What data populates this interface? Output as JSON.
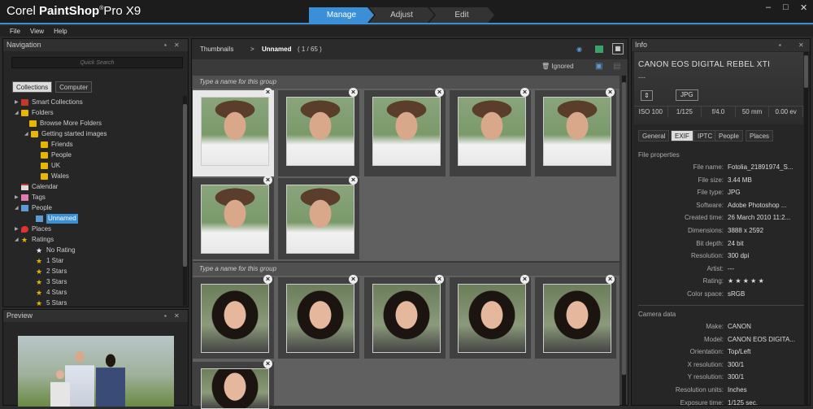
{
  "app": {
    "brand": "Corel",
    "product": "PaintShop",
    "suffix": "Pro X9"
  },
  "tabs": [
    "Manage",
    "Adjust",
    "Edit"
  ],
  "window_controls": [
    "–",
    "□",
    "✕"
  ],
  "menu": [
    "File",
    "View",
    "Help"
  ],
  "navigation": {
    "title": "Navigation",
    "quick_search": "Quick Search",
    "buttons": [
      "Collections",
      "Computer"
    ],
    "tree": [
      {
        "label": "Smart Collections",
        "icon": "smart-collections-icon"
      },
      {
        "label": "Folders",
        "icon": "folder-icon"
      },
      {
        "label": "Browse More Folders",
        "icon": "folder-add-icon"
      },
      {
        "label": "Getting started images",
        "icon": "folder-icon"
      },
      {
        "label": "Friends",
        "icon": "folder-icon"
      },
      {
        "label": "People",
        "icon": "folder-icon"
      },
      {
        "label": "UK",
        "icon": "folder-icon"
      },
      {
        "label": "Wales",
        "icon": "folder-icon"
      },
      {
        "label": "Calendar",
        "icon": "calendar-icon"
      },
      {
        "label": "Tags",
        "icon": "tag-icon"
      },
      {
        "label": "People",
        "icon": "people-icon"
      },
      {
        "label": "Unnamed",
        "icon": "person-icon"
      },
      {
        "label": "Places",
        "icon": "map-pin-icon"
      },
      {
        "label": "Ratings",
        "icon": "star-icon"
      },
      {
        "label": "No Rating",
        "icon": "star-outline-icon"
      },
      {
        "label": "1 Star",
        "icon": "star-icon"
      },
      {
        "label": "2 Stars",
        "icon": "star-icon"
      },
      {
        "label": "3 Stars",
        "icon": "star-icon"
      },
      {
        "label": "4 Stars",
        "icon": "star-icon"
      },
      {
        "label": "5 Stars",
        "icon": "star-icon"
      }
    ]
  },
  "preview": {
    "title": "Preview"
  },
  "thumbnails": {
    "title": "Thumbnails",
    "sep": ">",
    "crumb": "Unnamed",
    "count": "( 1 / 65 )",
    "ignored": "Ignored",
    "groups": [
      {
        "label": "Type a name for this group"
      },
      {
        "label": "Type a name for this group"
      }
    ]
  },
  "info": {
    "title": "Info",
    "camera": "CANON EOS DIGITAL REBEL XTI",
    "dash": "---",
    "format": "JPG",
    "exposure": [
      "ISO 100",
      "1/125",
      "f/4.0",
      "50 mm",
      "0.00 ev"
    ],
    "tabs": [
      "General",
      "EXIF",
      "IPTC",
      "People",
      "Places"
    ],
    "file_section": "File properties",
    "file_props": [
      {
        "k": "File name:",
        "v": "Fotolia_21891974_S..."
      },
      {
        "k": "File size:",
        "v": "3.44 MB"
      },
      {
        "k": "File type:",
        "v": "JPG"
      },
      {
        "k": "Software:",
        "v": "Adobe Photoshop ..."
      },
      {
        "k": "Created time:",
        "v": "26 March 2010 11:2..."
      },
      {
        "k": "Dimensions:",
        "v": "3888 x 2592"
      },
      {
        "k": "Bit depth:",
        "v": "24 bit"
      },
      {
        "k": "Resolution:",
        "v": "300 dpi"
      },
      {
        "k": "Artist:",
        "v": "---"
      },
      {
        "k": "Rating:",
        "v": "★ ★ ★ ★ ★"
      },
      {
        "k": "Color space:",
        "v": "sRGB"
      }
    ],
    "camera_section": "Camera data",
    "camera_props": [
      {
        "k": "Make:",
        "v": "CANON"
      },
      {
        "k": "Model:",
        "v": "CANON EOS DIGITA..."
      },
      {
        "k": "Orientation:",
        "v": "Top/Left"
      },
      {
        "k": "X resolution:",
        "v": "300/1"
      },
      {
        "k": "Y resolution:",
        "v": "300/1"
      },
      {
        "k": "Resolution units:",
        "v": "Inches"
      },
      {
        "k": "Exposure time:",
        "v": "1/125 sec."
      }
    ]
  },
  "colors": {
    "accent": "#3a8fd6",
    "folder": "#e8b500"
  }
}
